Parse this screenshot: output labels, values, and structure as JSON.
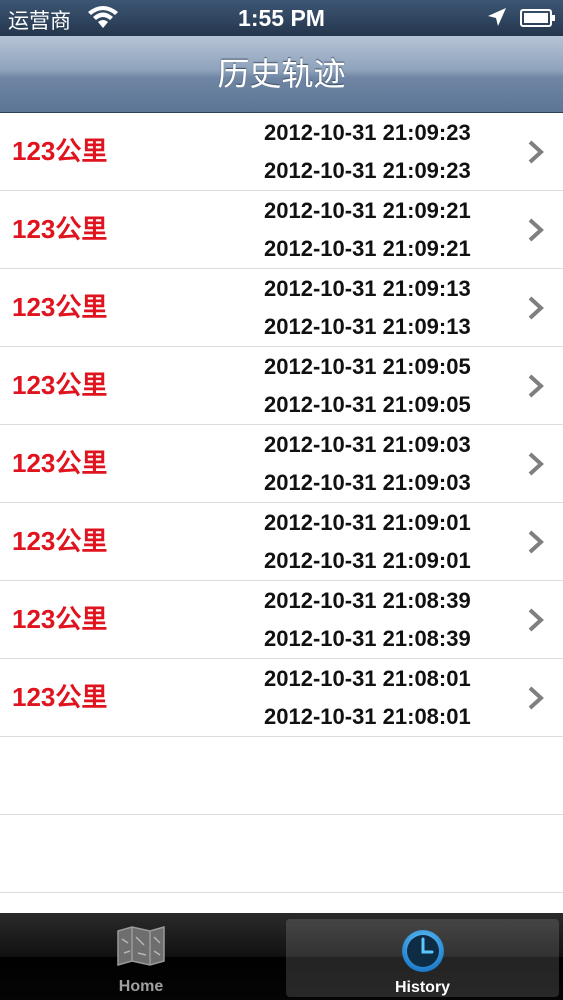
{
  "status_bar": {
    "carrier": "运营商",
    "time": "1:55 PM"
  },
  "nav": {
    "title": "历史轨迹"
  },
  "rows": [
    {
      "distance_value": "123",
      "distance_unit": "公里",
      "start": "2012-10-31 21:09:23",
      "end": "2012-10-31 21:09:23"
    },
    {
      "distance_value": "123",
      "distance_unit": "公里",
      "start": "2012-10-31 21:09:21",
      "end": "2012-10-31 21:09:21"
    },
    {
      "distance_value": "123",
      "distance_unit": "公里",
      "start": "2012-10-31 21:09:13",
      "end": "2012-10-31 21:09:13"
    },
    {
      "distance_value": "123",
      "distance_unit": "公里",
      "start": "2012-10-31 21:09:05",
      "end": "2012-10-31 21:09:05"
    },
    {
      "distance_value": "123",
      "distance_unit": "公里",
      "start": "2012-10-31 21:09:03",
      "end": "2012-10-31 21:09:03"
    },
    {
      "distance_value": "123",
      "distance_unit": "公里",
      "start": "2012-10-31 21:09:01",
      "end": "2012-10-31 21:09:01"
    },
    {
      "distance_value": "123",
      "distance_unit": "公里",
      "start": "2012-10-31 21:08:39",
      "end": "2012-10-31 21:08:39"
    },
    {
      "distance_value": "123",
      "distance_unit": "公里",
      "start": "2012-10-31 21:08:01",
      "end": "2012-10-31 21:08:01"
    }
  ],
  "tab_bar": {
    "home_label": "Home",
    "history_label": "History",
    "selected": "History",
    "home_icon": "map-icon",
    "history_icon": "clock-icon"
  },
  "colors": {
    "distance": "#e0141e",
    "nav_bar": "#6f86a4",
    "clock_accent": "#2ea0ea"
  }
}
